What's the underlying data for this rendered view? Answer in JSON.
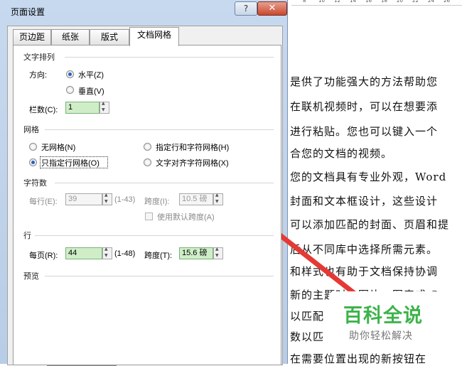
{
  "dialog": {
    "title": "页面设置",
    "help_label": "?",
    "close_label": "✕",
    "tabs": [
      "页边距",
      "纸张",
      "版式",
      "文档网格"
    ],
    "active_tab": "文档网格"
  },
  "text_arrangement": {
    "group_label": "文字排列",
    "direction_label": "方向:",
    "options": [
      "水平(Z)",
      "垂直(V)"
    ],
    "selected": "水平(Z)",
    "columns_label": "栏数(C):",
    "columns_value": "1"
  },
  "grid": {
    "group_label": "网格",
    "options": [
      "无网格(N)",
      "指定行和字符网格(H)",
      "只指定行网格(O)",
      "文字对齐字符网格(X)"
    ],
    "selected": "只指定行网格(O)"
  },
  "characters": {
    "group_label": "字符数",
    "per_line_label": "每行(E):",
    "per_line_value": "39",
    "per_line_range": "(1-43)",
    "pitch_label": "跨度(I):",
    "pitch_value": "10.5 磅",
    "default_pitch_label": "使用默认跨度(A)"
  },
  "lines": {
    "group_label": "行",
    "per_page_label": "每页(R):",
    "per_page_value": "44",
    "per_page_range": "(1-48)",
    "pitch_label": "跨度(T):",
    "pitch_value": "15.6 磅"
  },
  "preview": {
    "group_label": "预览"
  },
  "document": {
    "ruler_ticks": [
      "8",
      "10",
      "12",
      "14",
      "16",
      "18",
      "20",
      "22",
      "24",
      "26"
    ],
    "lines": [
      "是供了功能强大的方法帮助您",
      "在联机视频时，可以在想要添",
      "进行粘贴。您也可以键入一个",
      "合您的文档的视频。",
      "您的文档具有专业外观，Word",
      "封面和文本框设计，这些设计",
      "可以添加匹配的封面、页眉和提",
      "后从不同库中选择所需元素。",
      "和样式也有助于文档保持协调",
      "新的主题时，图片、图表或 S",
      "以匹配",
      "数以匹",
      "在需要位置出现的新按钮在"
    ]
  },
  "watermark": {
    "title": "百科全说",
    "subtitle": "助你轻松解决"
  },
  "colors": {
    "arrow": "#e53935",
    "watermark_green": "#3db34a",
    "field_green": "#cfeec8"
  }
}
